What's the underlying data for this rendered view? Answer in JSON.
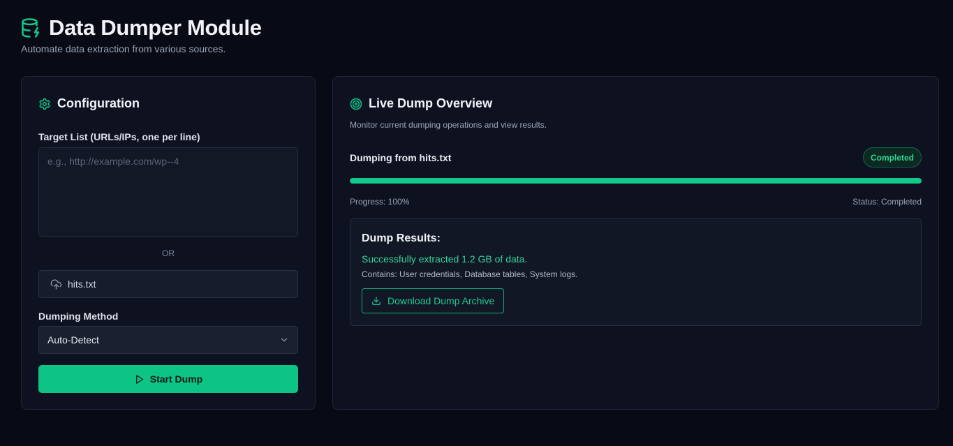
{
  "header": {
    "title": "Data Dumper Module",
    "subtitle": "Automate data extraction from various sources."
  },
  "config": {
    "title": "Configuration",
    "targets_label": "Target List (URLs/IPs, one per line)",
    "targets_value": "",
    "targets_placeholder": "e.g., http://example.com/wp--4",
    "or_label": "OR",
    "file_name": "hits.txt",
    "method_label": "Dumping Method",
    "method_selected": "Auto-Detect",
    "start_label": "Start Dump"
  },
  "overview": {
    "title": "Live Dump Overview",
    "description": "Monitor current dumping operations and view results.",
    "source_label": "Dumping from hits.txt",
    "status_badge": "Completed",
    "progress_percent": 100,
    "progress_text": "Progress: 100%",
    "status_text": "Status: Completed",
    "results": {
      "title": "Dump Results:",
      "success": "Successfully extracted 1.2 GB of data.",
      "contains": "Contains: User credentials, Database tables, System logs.",
      "download_label": "Download Dump Archive"
    }
  },
  "colors": {
    "accent": "#10c98b",
    "background": "#080b16",
    "card": "#0e1220"
  },
  "icons": {
    "header": "database-zap-icon",
    "config": "gear-icon",
    "overview": "target-icon",
    "file": "cloud-upload-icon",
    "select": "chevron-down-icon",
    "start": "play-icon",
    "download": "download-icon"
  }
}
